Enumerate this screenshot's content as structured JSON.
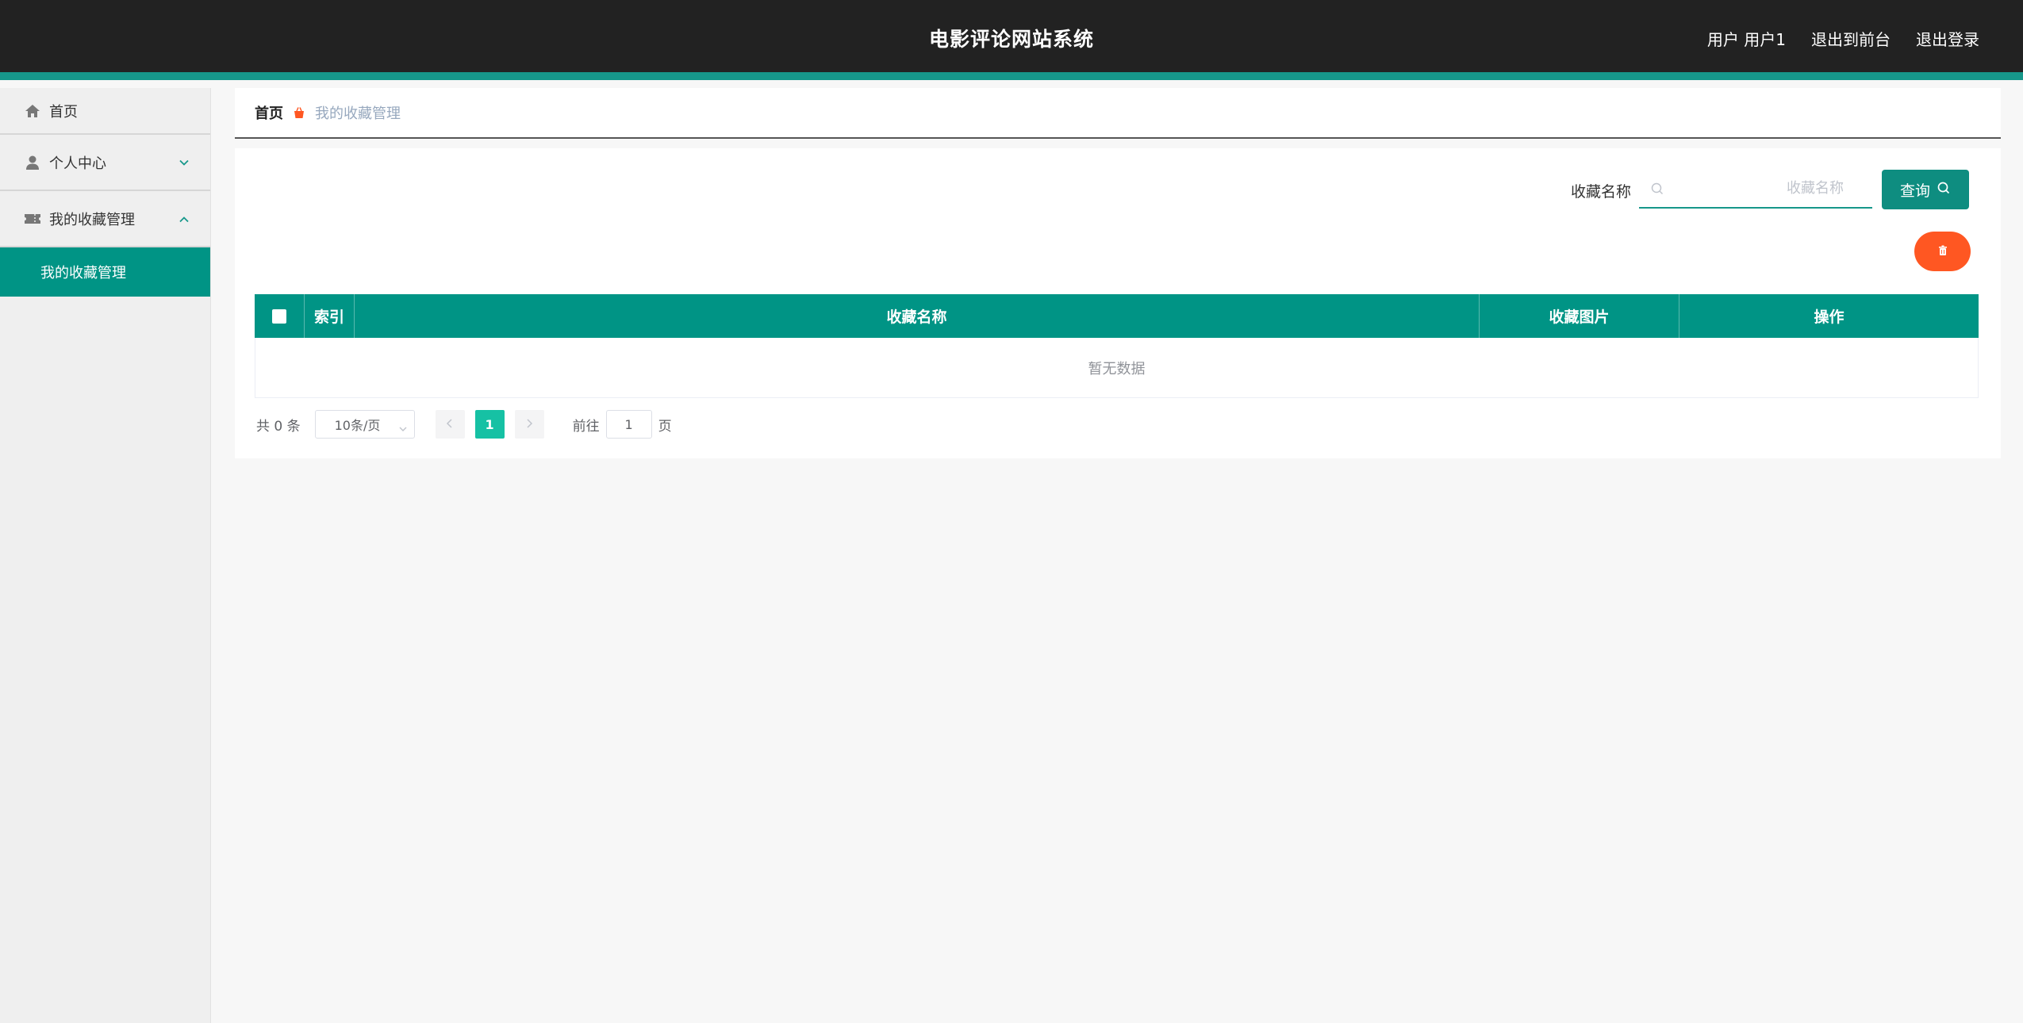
{
  "header": {
    "title": "电影评论网站系统",
    "user_label": "用户 用户1",
    "to_front_label": "退出到前台",
    "logout_label": "退出登录"
  },
  "sidebar": {
    "items": [
      {
        "label": "首页",
        "icon": "home-icon"
      },
      {
        "label": "个人中心",
        "icon": "user-icon",
        "expanded": false
      },
      {
        "label": "我的收藏管理",
        "icon": "ticket-icon",
        "expanded": true
      }
    ],
    "submenu": [
      {
        "label": "我的收藏管理",
        "active": true
      }
    ]
  },
  "breadcrumb": {
    "home": "首页",
    "current": "我的收藏管理"
  },
  "search": {
    "label": "收藏名称",
    "placeholder": "收藏名称",
    "value": "",
    "query_label": "查询"
  },
  "table": {
    "columns": [
      "索引",
      "收藏名称",
      "收藏图片",
      "操作"
    ],
    "rows": [],
    "empty_text": "暂无数据"
  },
  "pagination": {
    "total_text": "共 0 条",
    "page_size": "10条/页",
    "current_page": "1",
    "goto_label": "前往",
    "goto_value": "1",
    "page_suffix": "页"
  },
  "colors": {
    "accent": "#009485",
    "header_bg": "#222222",
    "danger": "#ff5722",
    "pager_active": "#16c1a4"
  }
}
